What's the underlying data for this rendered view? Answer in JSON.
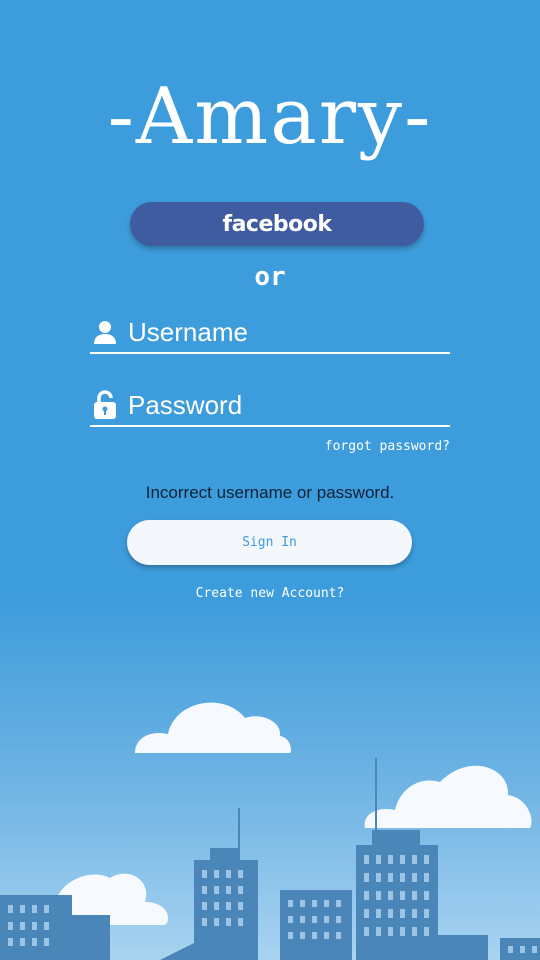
{
  "app": {
    "title": "-Amary-"
  },
  "facebook_button": {
    "label": "facebook"
  },
  "divider_text": "or",
  "username": {
    "placeholder": "Username",
    "value": "",
    "icon": "user-icon"
  },
  "password": {
    "placeholder": "Password",
    "value": "",
    "icon": "lock-icon"
  },
  "forgot_password": {
    "label": "forgot password?"
  },
  "error_message": "Incorrect username or password.",
  "sign_in_button": {
    "label": "Sign In"
  },
  "create_account": {
    "label": "Create new Account?"
  },
  "colors": {
    "background": "#3d9cdb",
    "facebook": "#3f5ca1",
    "button_bg": "#f4f8fc",
    "button_text": "#3d9cdb",
    "building": "#4a86b8",
    "cloud": "#f6f9fd"
  }
}
